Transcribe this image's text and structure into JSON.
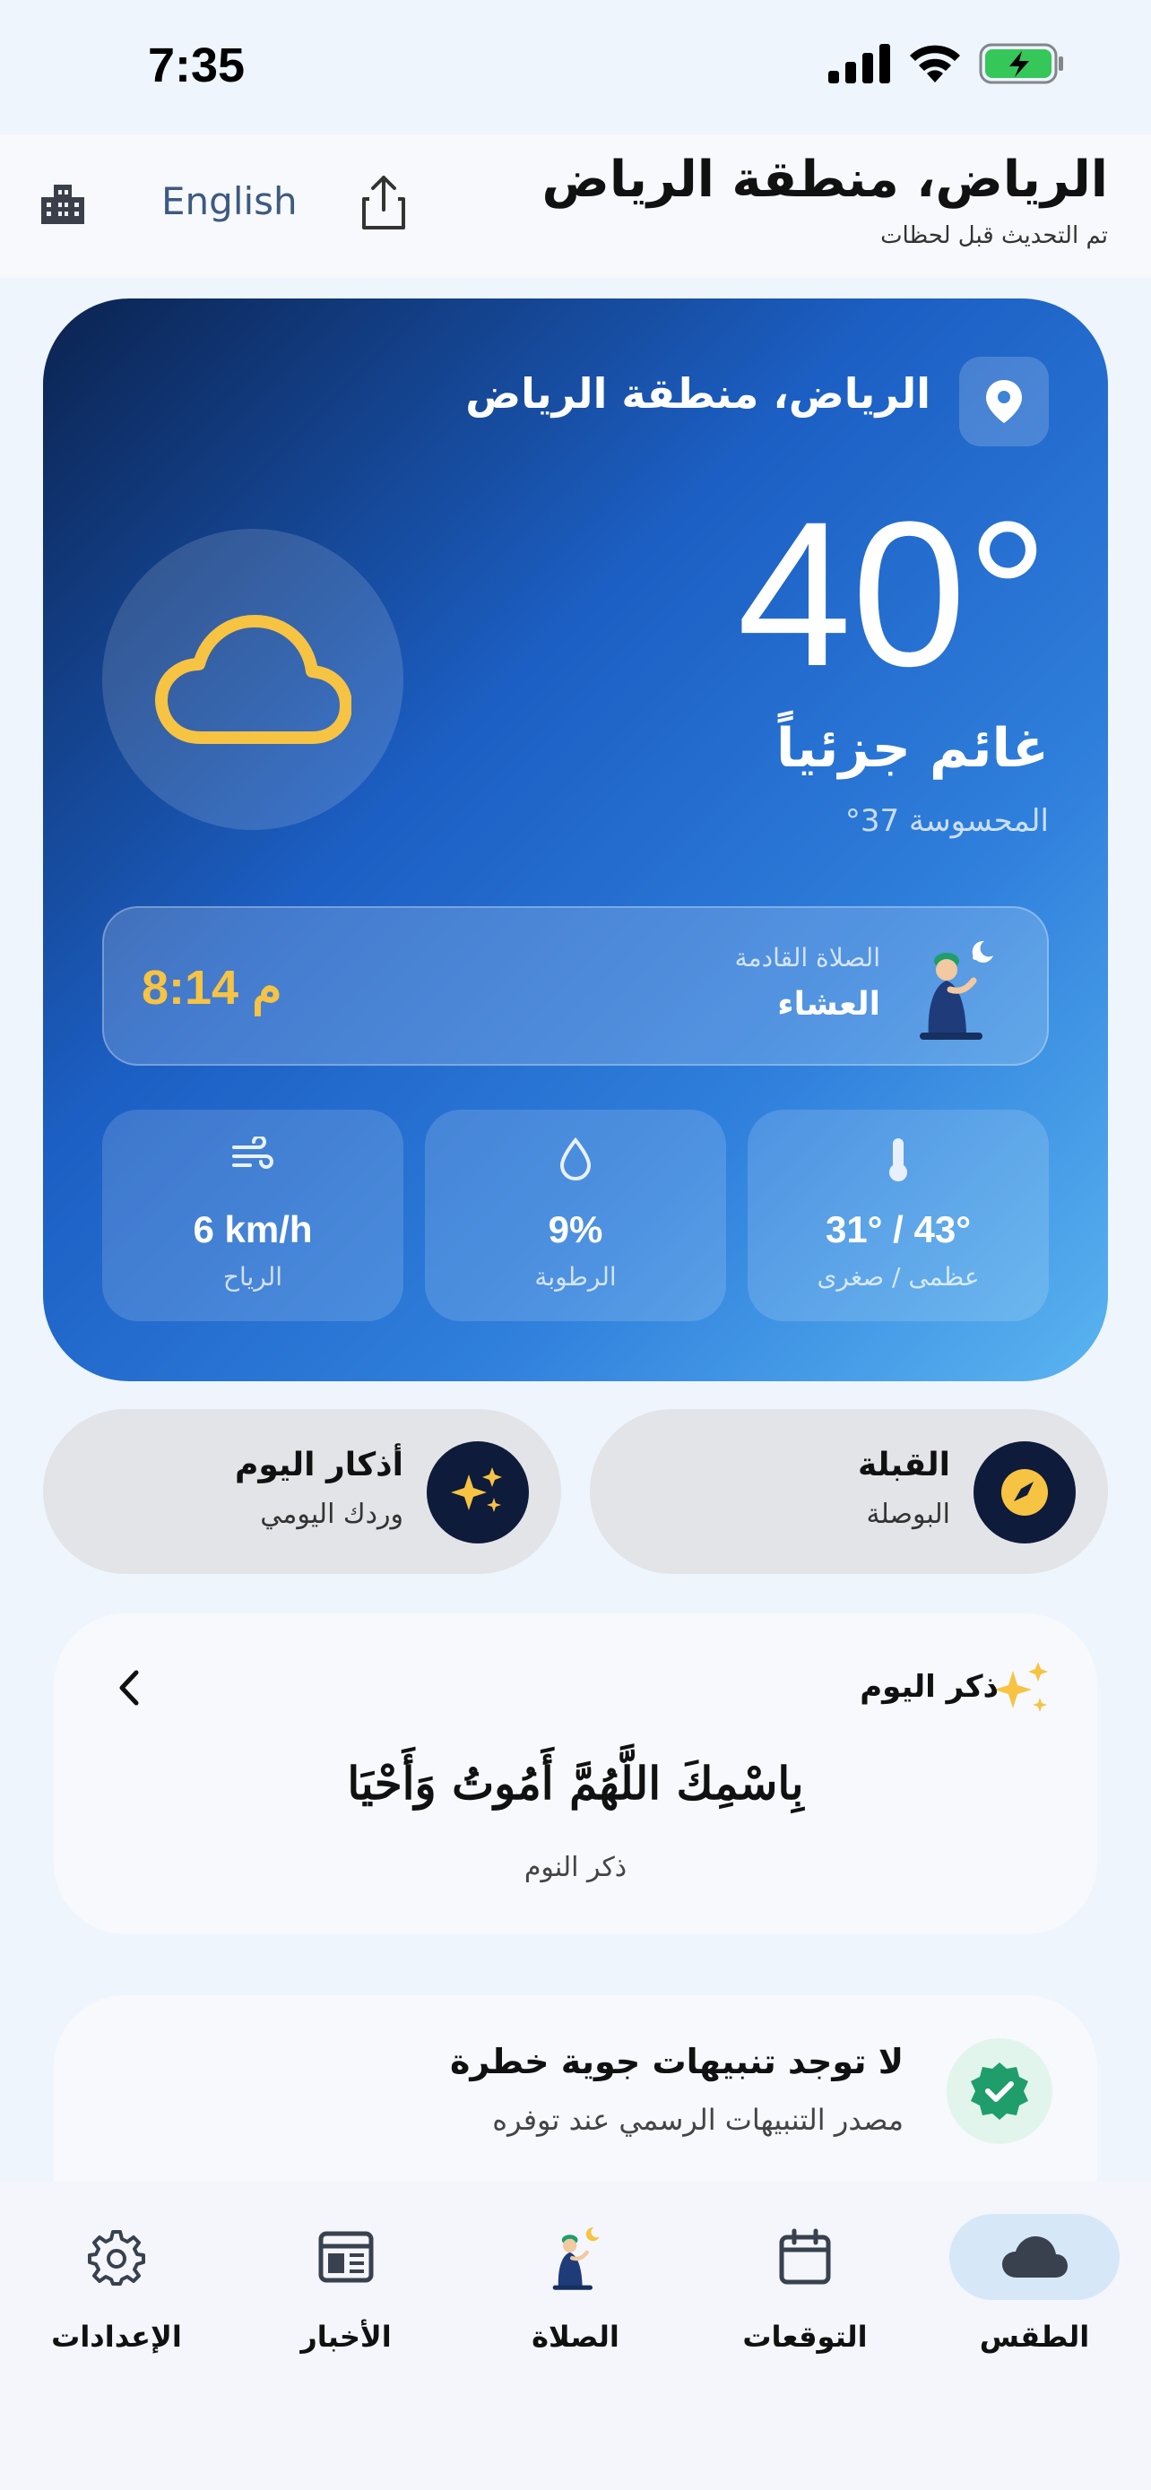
{
  "status": {
    "time": "7:35"
  },
  "header": {
    "title": "الرياض، منطقة الرياض",
    "subtitle": "تم التحديث قبل لحظات",
    "language": "English"
  },
  "hero": {
    "location": "الرياض، منطقة الرياض",
    "temperature": "40°",
    "condition": "غائم جزئياً",
    "feels_like": "المحسوسة 37°",
    "weather_icon": "cloud-icon",
    "accent_color": "#f6c343"
  },
  "prayer": {
    "next_label": "الصلاة القادمة",
    "name": "العشاء",
    "time": "8:14 م"
  },
  "stats": [
    {
      "icon": "thermometer-icon",
      "value": "31° / 43°",
      "label": "عظمى / صغرى"
    },
    {
      "icon": "droplet-icon",
      "value": "9%",
      "label": "الرطوبة"
    },
    {
      "icon": "wind-icon",
      "value": "6 km/h",
      "label": "الرياح"
    }
  ],
  "quick": {
    "qibla": {
      "title": "القبلة",
      "subtitle": "البوصلة"
    },
    "azkar": {
      "title": "أذكار اليوم",
      "subtitle": "وردك اليومي"
    }
  },
  "zikr": {
    "title": "ذكر اليوم",
    "text": "بِاسْمِكَ اللَّهُمَّ أَمُوتُ وَأَحْيَا",
    "source": "ذكر النوم"
  },
  "alerts": {
    "title": "لا توجد تنبيهات جوية خطرة",
    "subtitle": "مصدر التنبيهات الرسمي عند توفره",
    "status_color": "#1f9d6b"
  },
  "tabs": [
    {
      "label": "الطقس",
      "icon": "cloud-icon",
      "active": true
    },
    {
      "label": "التوقعات",
      "icon": "calendar-icon"
    },
    {
      "label": "الصلاة",
      "icon": "prayer-icon"
    },
    {
      "label": "الأخبار",
      "icon": "news-icon"
    },
    {
      "label": "الإعدادات",
      "icon": "gear-icon"
    }
  ]
}
